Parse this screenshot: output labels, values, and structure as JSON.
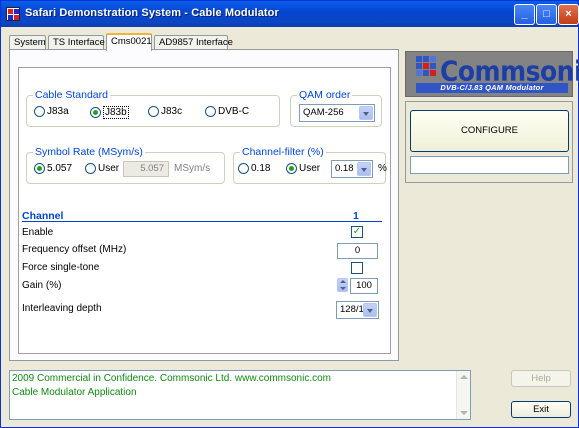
{
  "window": {
    "title": "Safari Demonstration System - Cable Modulator"
  },
  "tabs": [
    {
      "label": "System"
    },
    {
      "label": "TS Interface"
    },
    {
      "label": "Cms0021"
    },
    {
      "label": "AD9857 Interface"
    }
  ],
  "cable_standard": {
    "legend": "Cable Standard",
    "options": [
      "J83a",
      "J83b",
      "J83c",
      "DVB-C"
    ],
    "selected": "J83b"
  },
  "qam_order": {
    "legend": "QAM order",
    "value": "QAM-256"
  },
  "symbol_rate": {
    "legend": "Symbol Rate (MSym/s)",
    "preset": "5.057",
    "user_label": "User",
    "user_value": "5.057",
    "unit": "MSym/s"
  },
  "channel_filter": {
    "legend": "Channel-filter (%)",
    "preset": "0.18",
    "user_label": "User",
    "user_value": "0.18",
    "unit": "%"
  },
  "channel": {
    "heading": "Channel",
    "number": "1",
    "enable_label": "Enable",
    "enable_checked": true,
    "freq_offset_label": "Frequency offset (MHz)",
    "freq_offset_value": "0",
    "force_tone_label": "Force single-tone",
    "force_tone_checked": false,
    "gain_label": "Gain (%)",
    "gain_value": "100",
    "interleave_label": "Interleaving depth",
    "interleave_value": "128/1"
  },
  "logo": {
    "name": "Commsonic",
    "strap": "DVB-C/J.83 QAM Modulator"
  },
  "configure": {
    "label": "CONFIGURE",
    "status": ""
  },
  "log": {
    "lines": [
      "2009 Commercial in Confidence. Commsonic Ltd.     www.commsonic.com",
      "Cable Modulator Application"
    ]
  },
  "buttons": {
    "help": "Help",
    "exit": "Exit"
  },
  "colors": {
    "title_bar": "#0a5ee8",
    "legend_text": "#0046d5",
    "log_text": "#118a11",
    "logo_blue": "#1b3ea7"
  }
}
